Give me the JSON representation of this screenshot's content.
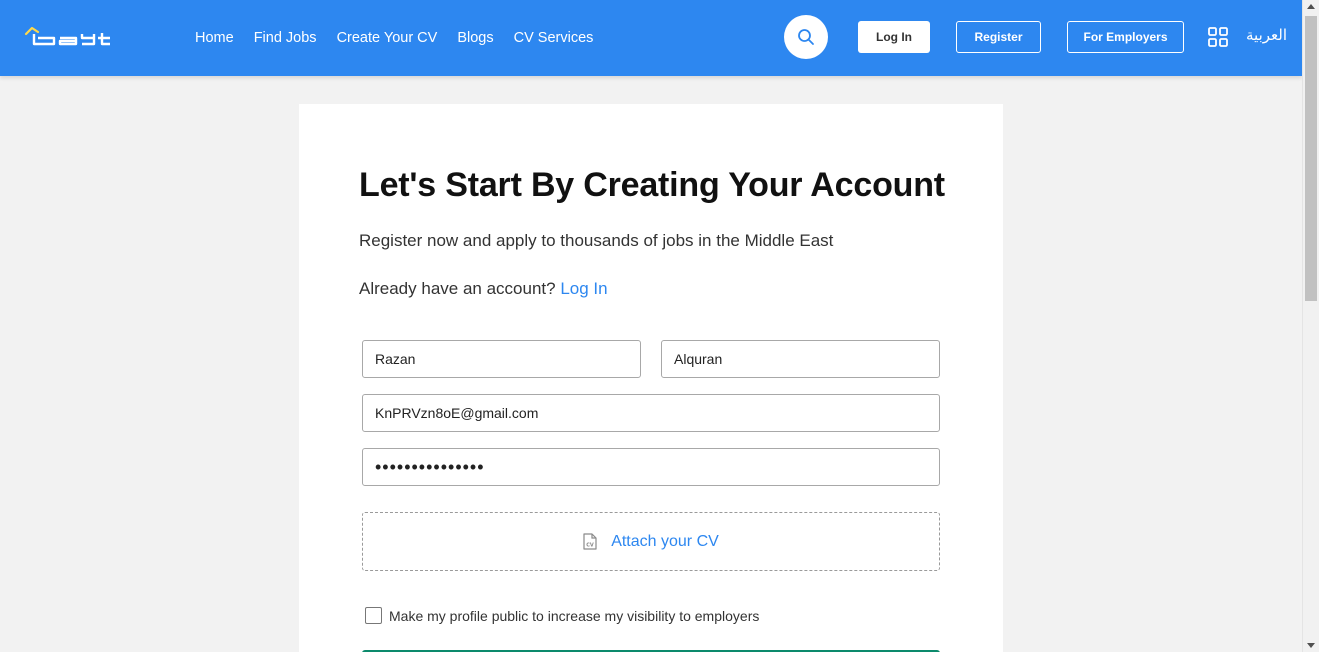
{
  "header": {
    "nav": [
      "Home",
      "Find Jobs",
      "Create Your CV",
      "Blogs",
      "CV Services"
    ],
    "login_label": "Log In",
    "register_label": "Register",
    "employers_label": "For Employers",
    "language_label": "العربية",
    "brand_color": "#2d87f0",
    "icons": [
      "bayt-logo",
      "search-icon",
      "apps-grid-icon"
    ]
  },
  "form": {
    "title": "Let's Start By Creating Your Account",
    "subtitle": "Register now and apply to thousands of jobs in the Middle East",
    "already_text": "Already have an account?",
    "login_link": "Log In",
    "first_name": "Razan",
    "last_name": "Alquran",
    "email": "KnPRVzn8oE@gmail.com",
    "password": "•••••••••••••••",
    "attach_label": "Attach your CV",
    "public_profile_label": "Make my profile public to increase my visibility to employers",
    "submit_color": "#0c8a6c"
  }
}
